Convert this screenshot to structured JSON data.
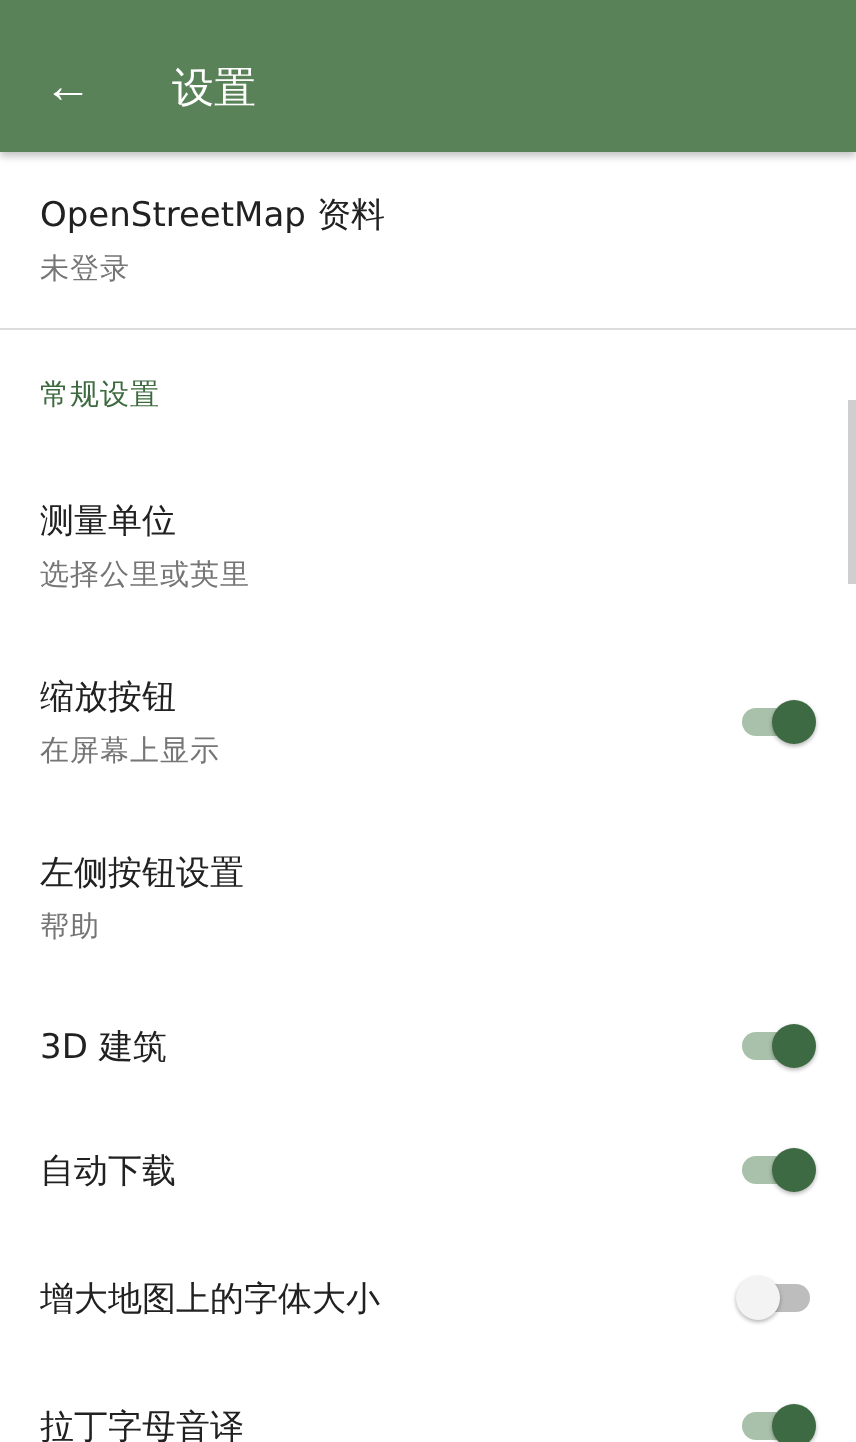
{
  "toolbar": {
    "back_icon": "←",
    "title": "设置"
  },
  "account": {
    "title": "OpenStreetMap 资料",
    "subtitle": "未登录"
  },
  "section": {
    "title": "常规设置",
    "items": [
      {
        "kind": "plain",
        "title": "测量单位",
        "subtitle": "选择公里或英里"
      },
      {
        "kind": "switch",
        "title": "缩放按钮",
        "subtitle": "在屏幕上显示",
        "on": true
      },
      {
        "kind": "plain",
        "title": "左侧按钮设置",
        "subtitle": "帮助"
      },
      {
        "kind": "switch",
        "title": "3D 建筑",
        "on": true
      },
      {
        "kind": "switch",
        "title": "自动下载",
        "on": true
      },
      {
        "kind": "switch",
        "title": "增大地图上的字体大小",
        "on": false
      },
      {
        "kind": "switch",
        "title": "拉丁字母音译",
        "on": true
      }
    ]
  }
}
